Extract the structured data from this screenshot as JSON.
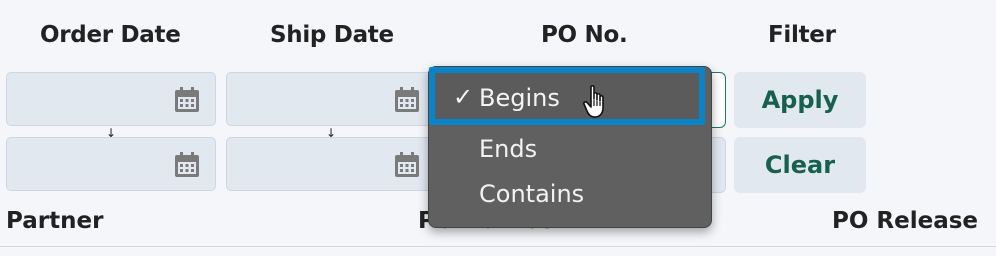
{
  "headers": {
    "order_date": "Order Date",
    "ship_date": "Ship Date",
    "po_no": "PO No.",
    "filter": "Filter"
  },
  "buttons": {
    "apply": "Apply",
    "clear": "Clear"
  },
  "po_match_dropdown": {
    "options": [
      "Begins",
      "Ends",
      "Contains"
    ],
    "selected": "Begins",
    "check_glyph": "✓"
  },
  "range_arrow": "↓",
  "columns": {
    "partner": "Partner",
    "po_number": "PO Number",
    "po_release": "PO Release"
  },
  "colors": {
    "accent_green": "#17604d",
    "focus_blue": "#0a84c8",
    "menu_bg": "#5f605f",
    "field_bg": "#e2e8f0"
  },
  "icons": {
    "date_picker": "calendar-icon",
    "pointer": "hand-cursor-icon"
  }
}
